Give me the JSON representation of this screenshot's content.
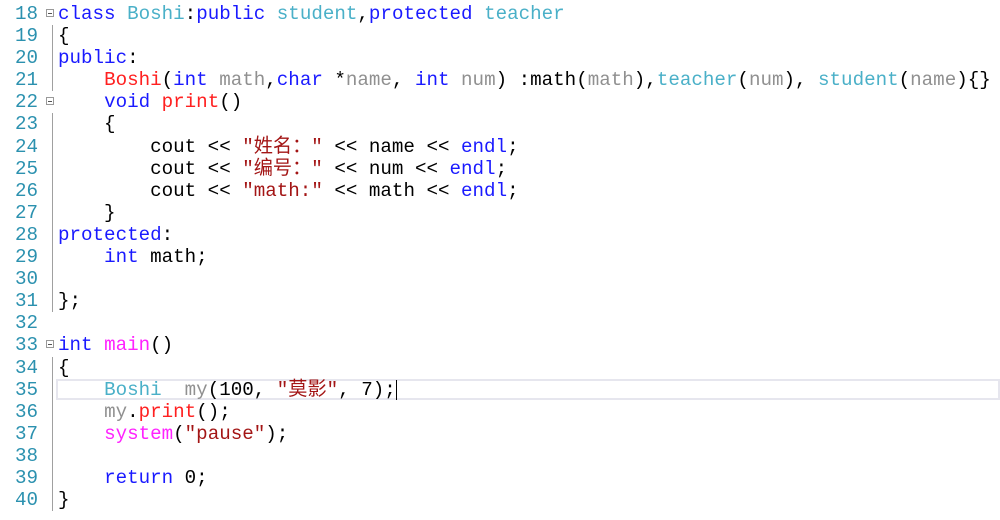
{
  "colors": {
    "keyword": "#1a1aff",
    "type": "#4ab0c8",
    "function": "#ff2020",
    "param": "#909090",
    "string": "#a31515",
    "macro": "#ff22ff",
    "line_number": "#2b91af"
  },
  "current_line": 35,
  "lines": [
    {
      "num": "18",
      "fold": true,
      "tokens": [
        [
          "kw",
          "class "
        ],
        [
          "ty",
          "Boshi"
        ],
        [
          "tx",
          ":"
        ],
        [
          "kw",
          "public "
        ],
        [
          "ty",
          "student"
        ],
        [
          "tx",
          ","
        ],
        [
          "kw",
          "protected "
        ],
        [
          "ty",
          "teacher"
        ]
      ]
    },
    {
      "num": "19",
      "tokens": [
        [
          "tx",
          "{"
        ]
      ]
    },
    {
      "num": "20",
      "tokens": [
        [
          "kw",
          "public"
        ],
        [
          "tx",
          ":"
        ]
      ]
    },
    {
      "num": "21",
      "tokens": [
        [
          "tx",
          "    "
        ],
        [
          "fn",
          "Boshi"
        ],
        [
          "tx",
          "("
        ],
        [
          "kw",
          "int "
        ],
        [
          "pm",
          "math"
        ],
        [
          "tx",
          ","
        ],
        [
          "kw",
          "char "
        ],
        [
          "tx",
          "*"
        ],
        [
          "pm",
          "name"
        ],
        [
          "tx",
          ", "
        ],
        [
          "kw",
          "int "
        ],
        [
          "pm",
          "num"
        ],
        [
          "tx",
          ") :math("
        ],
        [
          "pm",
          "math"
        ],
        [
          "tx",
          "),"
        ],
        [
          "ty",
          "teacher"
        ],
        [
          "tx",
          "("
        ],
        [
          "pm",
          "num"
        ],
        [
          "tx",
          "), "
        ],
        [
          "ty",
          "student"
        ],
        [
          "tx",
          "("
        ],
        [
          "pm",
          "name"
        ],
        [
          "tx",
          "){}"
        ]
      ]
    },
    {
      "num": "22",
      "fold": true,
      "tokens": [
        [
          "tx",
          "    "
        ],
        [
          "kw",
          "void "
        ],
        [
          "fn",
          "print"
        ],
        [
          "tx",
          "()"
        ]
      ]
    },
    {
      "num": "23",
      "tokens": [
        [
          "tx",
          "    {"
        ]
      ]
    },
    {
      "num": "24",
      "tokens": [
        [
          "tx",
          "        cout << "
        ],
        [
          "st",
          "\"姓名：\""
        ],
        [
          "tx",
          " << name << "
        ],
        [
          "kw",
          "endl"
        ],
        [
          "tx",
          ";"
        ]
      ]
    },
    {
      "num": "25",
      "tokens": [
        [
          "tx",
          "        cout << "
        ],
        [
          "st",
          "\"编号：\""
        ],
        [
          "tx",
          " << num << "
        ],
        [
          "kw",
          "endl"
        ],
        [
          "tx",
          ";"
        ]
      ]
    },
    {
      "num": "26",
      "tokens": [
        [
          "tx",
          "        cout << "
        ],
        [
          "st",
          "\"math:\""
        ],
        [
          "tx",
          " << math << "
        ],
        [
          "kw",
          "endl"
        ],
        [
          "tx",
          ";"
        ]
      ]
    },
    {
      "num": "27",
      "tokens": [
        [
          "tx",
          "    }"
        ]
      ]
    },
    {
      "num": "28",
      "tokens": [
        [
          "kw",
          "protected"
        ],
        [
          "tx",
          ":"
        ]
      ]
    },
    {
      "num": "29",
      "tokens": [
        [
          "tx",
          "    "
        ],
        [
          "kw",
          "int "
        ],
        [
          "tx",
          "math;"
        ]
      ]
    },
    {
      "num": "30",
      "tokens": []
    },
    {
      "num": "31",
      "tokens": [
        [
          "tx",
          "};"
        ]
      ]
    },
    {
      "num": "32",
      "tokens": []
    },
    {
      "num": "33",
      "fold": true,
      "tokens": [
        [
          "kw",
          "int "
        ],
        [
          "mg",
          "main"
        ],
        [
          "tx",
          "()"
        ]
      ]
    },
    {
      "num": "34",
      "tokens": [
        [
          "tx",
          "{"
        ]
      ]
    },
    {
      "num": "35",
      "tokens": [
        [
          "tx",
          "    "
        ],
        [
          "ty",
          "Boshi  "
        ],
        [
          "pm",
          "my"
        ],
        [
          "tx",
          "(100, "
        ],
        [
          "st",
          "\"莫影\""
        ],
        [
          "tx",
          ", 7);"
        ]
      ]
    },
    {
      "num": "36",
      "tokens": [
        [
          "tx",
          "    "
        ],
        [
          "pm",
          "my"
        ],
        [
          "tx",
          "."
        ],
        [
          "fn",
          "print"
        ],
        [
          "tx",
          "();"
        ]
      ]
    },
    {
      "num": "37",
      "tokens": [
        [
          "tx",
          "    "
        ],
        [
          "mg",
          "system"
        ],
        [
          "tx",
          "("
        ],
        [
          "st",
          "\"pause\""
        ],
        [
          "tx",
          ");"
        ]
      ]
    },
    {
      "num": "38",
      "tokens": []
    },
    {
      "num": "39",
      "tokens": [
        [
          "tx",
          "    "
        ],
        [
          "kw",
          "return "
        ],
        [
          "tx",
          "0;"
        ]
      ]
    },
    {
      "num": "40",
      "tokens": [
        [
          "tx",
          "}"
        ]
      ]
    }
  ]
}
